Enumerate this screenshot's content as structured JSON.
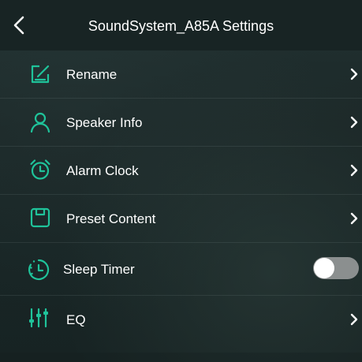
{
  "header": {
    "title": "SoundSystem_A85A Settings"
  },
  "accent_color": "#1fc39a",
  "items": [
    {
      "id": "rename",
      "label": "Rename",
      "icon": "edit-icon",
      "control": "chevron"
    },
    {
      "id": "speaker-info",
      "label": "Speaker Info",
      "icon": "person-icon",
      "control": "chevron"
    },
    {
      "id": "alarm-clock",
      "label": "Alarm Clock",
      "icon": "alarm-clock-icon",
      "control": "chevron"
    },
    {
      "id": "preset-content",
      "label": "Preset Content",
      "icon": "preset-icon",
      "control": "chevron"
    },
    {
      "id": "sleep-timer",
      "label": "Sleep Timer",
      "icon": "sleep-timer-icon",
      "control": "toggle",
      "enabled": false
    },
    {
      "id": "eq",
      "label": "EQ",
      "icon": "equalizer-icon",
      "control": "chevron"
    }
  ]
}
